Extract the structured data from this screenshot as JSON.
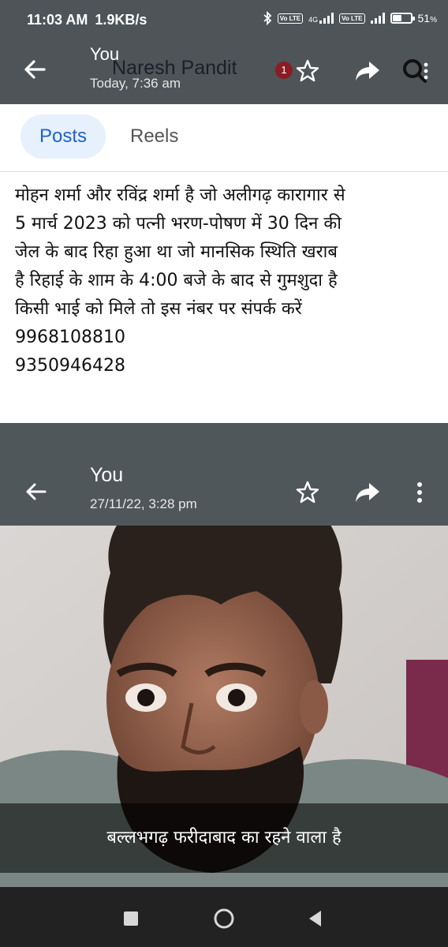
{
  "status_bar": {
    "time": "11:03 AM",
    "speed": "1.9KB/s",
    "battery": "51",
    "battery_level": 0.51,
    "lte1": "Vo LTE",
    "lte2": "Vo LTE",
    "net": "4G"
  },
  "app_bar": {
    "title": "You",
    "sender_overlay": "Naresh Pandit",
    "subtitle": "Today, 7:36 am",
    "badge": "1"
  },
  "tabs": [
    {
      "label": "Posts",
      "active": true
    },
    {
      "label": "Reels",
      "active": false
    }
  ],
  "post": {
    "lines": [
      "मोहन शर्मा और रविंद्र शर्मा  है जो अलीगढ़ कारागार से",
      "5 मार्च 2023  को पत्नी भरण-पोषण में 30 दिन की",
      "जेल के बाद रिहा हुआ था जो  मानसिक स्थिति खराब",
      "है रिहाई के शाम के 4:00 बजे के बाद से गुमशुदा है",
      "किसी भाई को मिले तो इस नंबर पर संपर्क करें",
      "9968108810",
      "9350946428"
    ]
  },
  "shared_screenshot": {
    "sender": "You",
    "date": "27/11/22, 3:28 pm",
    "caption": "बल्लभगढ़ फरीदाबाद का रहने वाला है"
  },
  "icons": {
    "back": "back-arrow-icon",
    "star": "star-icon",
    "forward": "forward-icon",
    "search": "search-icon",
    "more": "more-vert-icon",
    "nav_recent": "square-icon",
    "nav_home": "circle-icon",
    "nav_back": "triangle-icon"
  },
  "colors": {
    "app_bar": "#4e5457",
    "tab_active_bg": "#e7f0fd",
    "tab_active_text": "#1d63c8",
    "badge": "#8c1c24"
  }
}
